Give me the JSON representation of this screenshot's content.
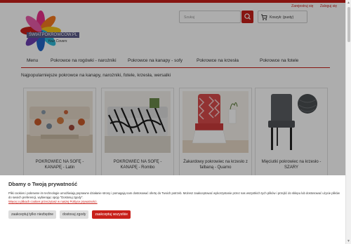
{
  "top_links": [
    "Zarejestruj się",
    "Zaloguj się"
  ],
  "logo": {
    "text": "ŚWIATPOKROWCÓW.PL",
    "tagline": "Your Covers"
  },
  "search": {
    "placeholder": "Szukaj"
  },
  "cart": {
    "label": "Koszyk: (pusty)"
  },
  "nav": [
    "Menu",
    "Pokrowce na rogówki - narożniki",
    "Pokrowce na kanapy - sofy",
    "Pokrowce na krzesła",
    "Pokrowce na fotele"
  ],
  "main": {
    "heading": "Najpopularniejsze pokrowce na kanapy, narożniki, fotele, krzesła, wersalki"
  },
  "products": [
    {
      "name": "POKROWIEC NA SOFĘ - KANAPĘ - Latin"
    },
    {
      "name": "POKROWIEC NA SOFĘ - KANAPĘ - Rombo"
    },
    {
      "name": "Żakardowy pokrowiec na krzesło z falbaną - Quarno"
    },
    {
      "name": "Mięciutki pokrowiec na krzesło - SZARY"
    }
  ],
  "cookie": {
    "title": "Dbamy o Twoją prywatność",
    "text": "Pliki cookies i pokrewne im technologie umożliwiają poprawne działanie strony i pomagają nam dostosować ofertę do Twoich potrzeb. Możesz zaakceptować wykorzystanie przez nas wszystkich tych plików i przejść do sklepu lub dostosować użycie plików do swoich preferencji, wybierając opcję \"Dostosuj zgody\".",
    "more_link": "Więcej o plikach cookies przeczytasz w naszej Polityce prywatności.",
    "buttons": {
      "necessary": "zaakceptuj tylko niezbędne",
      "customize": "dostosuj zgody",
      "accept_all": "zaakceptuj wszystkie"
    }
  },
  "colors": {
    "accent": "#c8201a",
    "overlay": "rgba(0,0,0,0.32)"
  }
}
